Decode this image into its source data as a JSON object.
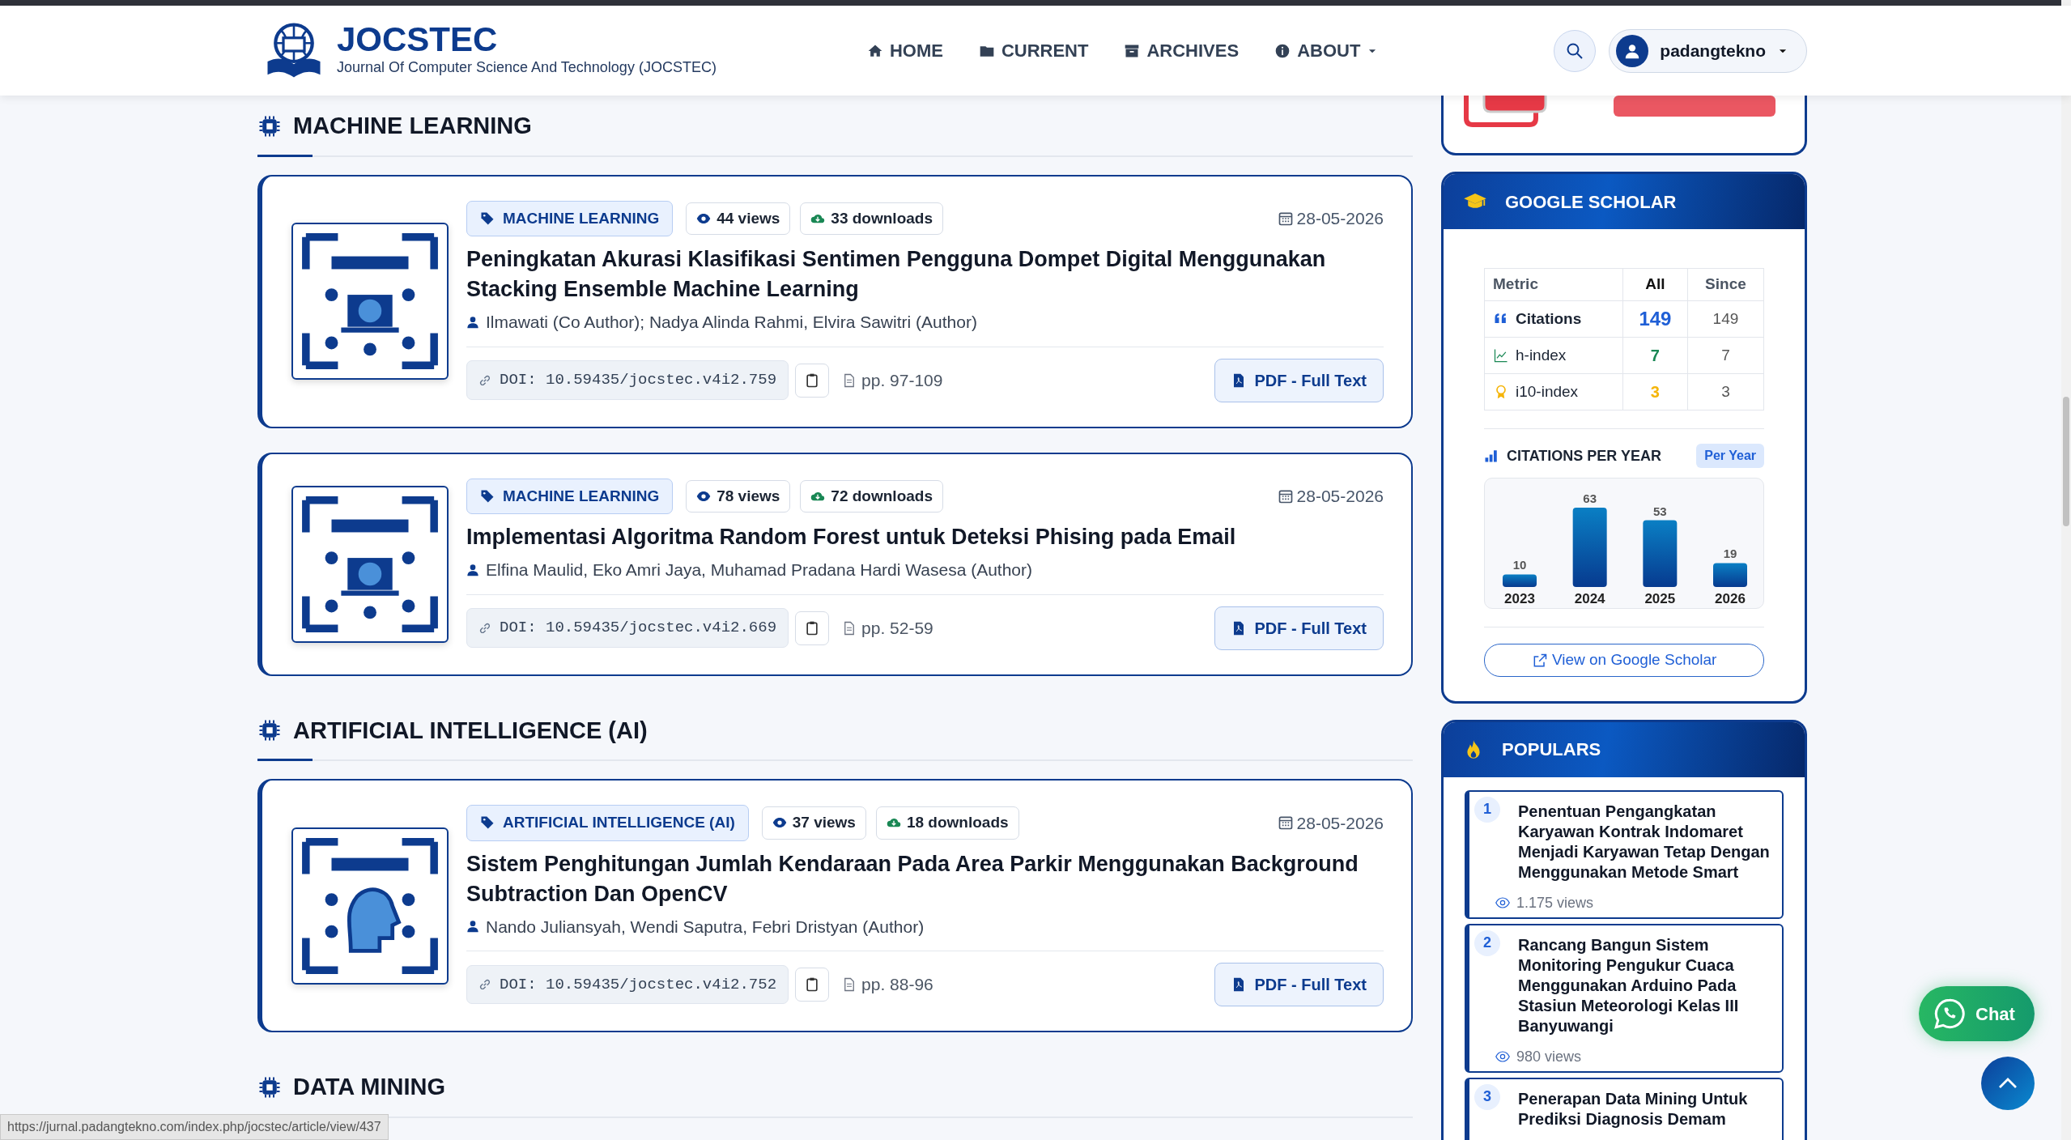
{
  "header": {
    "logo_title": "JOCSTEC",
    "logo_subtitle": "Journal Of Computer Science And Technology (JOCSTEC)",
    "nav": [
      {
        "label": "HOME",
        "dropdown": false
      },
      {
        "label": "CURRENT",
        "dropdown": false
      },
      {
        "label": "ARCHIVES",
        "dropdown": false
      },
      {
        "label": "ABOUT",
        "dropdown": true
      }
    ],
    "user": {
      "name": "padangtekno"
    }
  },
  "sections": [
    {
      "title": "MACHINE LEARNING",
      "articles": [
        {
          "category": "MACHINE LEARNING",
          "views": "44 views",
          "downloads": "33 downloads",
          "date": "28-05-2026",
          "title": "Peningkatan Akurasi Klasifikasi Sentimen Pengguna Dompet Digital Menggunakan Stacking Ensemble Machine Learning",
          "authors": "Ilmawati (Co Author); Nadya Alinda Rahmi, Elvira Sawitri (Author)",
          "doi": "DOI: 10.59435/jocstec.v4i2.759",
          "pages": "pp. 97-109",
          "pdf": "PDF - Full Text"
        },
        {
          "category": "MACHINE LEARNING",
          "views": "78 views",
          "downloads": "72 downloads",
          "date": "28-05-2026",
          "title": "Implementasi Algoritma Random Forest untuk Deteksi Phising pada Email",
          "authors": "Elfina Maulid, Eko Amri Jaya, Muhamad Pradana Hardi Wasesa (Author)",
          "doi": "DOI: 10.59435/jocstec.v4i2.669",
          "pages": "pp. 52-59",
          "pdf": "PDF - Full Text"
        }
      ]
    },
    {
      "title": "ARTIFICIAL INTELLIGENCE (AI)",
      "articles": [
        {
          "category": "ARTIFICIAL INTELLIGENCE (AI)",
          "views": "37 views",
          "downloads": "18 downloads",
          "date": "28-05-2026",
          "title": "Sistem Penghitungan Jumlah Kendaraan Pada Area Parkir Menggunakan Background Subtraction Dan OpenCV",
          "authors": "Nando Juliansyah, Wendi Saputra, Febri Dristyan (Author)",
          "doi": "DOI: 10.59435/jocstec.v4i2.752",
          "pages": "pp. 88-96",
          "pdf": "PDF - Full Text"
        }
      ]
    },
    {
      "title": "DATA MINING"
    }
  ],
  "sidebar": {
    "scholar": {
      "title": "GOOGLE SCHOLAR",
      "columns": [
        "Metric",
        "All",
        "Since"
      ],
      "rows": [
        {
          "kind": "citations",
          "metric": "Citations",
          "all": "149",
          "since": "149"
        },
        {
          "kind": "h_index",
          "metric": "h-index",
          "all": "7",
          "since": "7"
        },
        {
          "kind": "i10_index",
          "metric": "i10-index",
          "all": "3",
          "since": "3"
        }
      ],
      "chart_title": "CITATIONS PER YEAR",
      "chart_badge": "Per Year",
      "chart_data": {
        "type": "bar",
        "categories": [
          "2023",
          "2024",
          "2025",
          "2026"
        ],
        "values": [
          10,
          63,
          53,
          19
        ],
        "data_labels": true
      },
      "link": "View on Google Scholar"
    },
    "populars": {
      "title": "POPULARS",
      "items": [
        {
          "rank": "1",
          "title": "Penentuan Pengangkatan Karyawan Kontrak Indomaret Menjadi Karyawan Tetap Dengan Menggunakan Metode Smart",
          "views": "1.175 views"
        },
        {
          "rank": "2",
          "title": "Rancang Bangun Sistem Monitoring Pengukur Cuaca Menggunakan Arduino Pada Stasiun Meteorologi Kelas III Banyuwangi",
          "views": "980 views"
        },
        {
          "rank": "3",
          "title": "Penerapan Data Mining Untuk Prediksi Diagnosis Demam"
        }
      ]
    }
  },
  "chat_button": "Chat",
  "status_url": "https://jurnal.padangtekno.com/index.php/jocstec/article/view/437"
}
